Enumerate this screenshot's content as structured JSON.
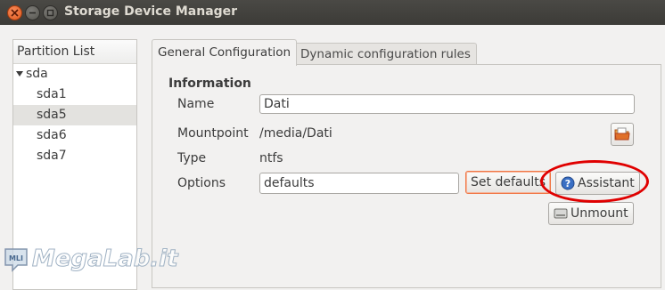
{
  "window": {
    "title": "Storage Device Manager"
  },
  "sidebar": {
    "header": "Partition List",
    "root": "sda",
    "items": [
      "sda1",
      "sda5",
      "sda6",
      "sda7"
    ],
    "selected": "sda5"
  },
  "tabs": [
    {
      "label": "General Configuration",
      "active": true
    },
    {
      "label": "Dynamic configuration rules",
      "active": false
    }
  ],
  "info": {
    "section_title": "Information",
    "name_label": "Name",
    "name_value": "Dati",
    "mountpoint_label": "Mountpoint",
    "mountpoint_value": "/media/Dati",
    "type_label": "Type",
    "type_value": "ntfs",
    "options_label": "Options",
    "options_value": "defaults"
  },
  "buttons": {
    "set_defaults": "Set defaults",
    "assistant": "Assistant",
    "unmount": "Unmount"
  },
  "watermark": {
    "text": "MegaLab.it",
    "badge": "MLI"
  },
  "colors": {
    "highlight": "#e00000",
    "focus_border": "#f07746",
    "titlebar": "#3c3b37"
  }
}
